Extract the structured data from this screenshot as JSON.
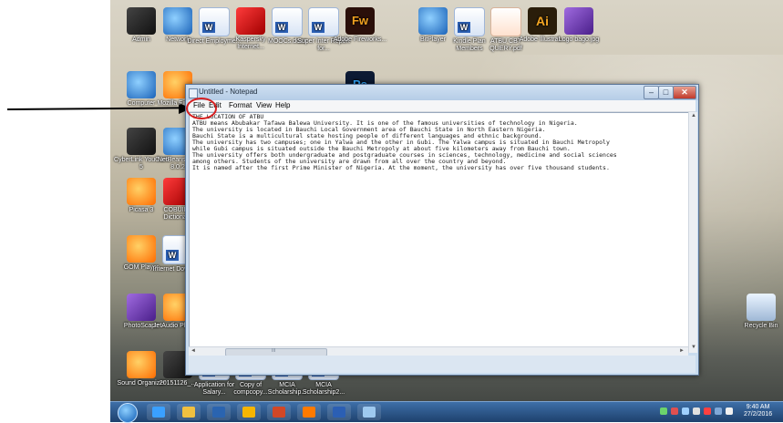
{
  "desktop": {
    "icons": [
      {
        "label": "Admin",
        "glyph": "g-dark",
        "icon": "user-folder-icon"
      },
      {
        "label": "Network",
        "glyph": "g-blue",
        "icon": "network-globe-icon"
      },
      {
        "label": "Direct Employme...",
        "glyph": "g-doc",
        "icon": "word-document-icon"
      },
      {
        "label": "Kaspersky Internet...",
        "glyph": "g-red",
        "icon": "kaspersky-icon"
      },
      {
        "label": "MOOCs.docx",
        "glyph": "g-doc",
        "icon": "word-document-icon"
      },
      {
        "label": "Super Inter Report for...",
        "glyph": "g-doc",
        "icon": "word-document-icon"
      },
      {
        "label": "Adobe Fireworks...",
        "glyph": "g-adobe",
        "icon": "fireworks-icon",
        "short": "Fw"
      },
      {
        "label": "BitPlayer",
        "glyph": "g-blue",
        "icon": "player-icon"
      },
      {
        "label": "Kindle Plan Members",
        "glyph": "g-doc",
        "icon": "word-document-icon"
      },
      {
        "label": "ATBU CBT QUERY.pdf",
        "glyph": "g-pdf",
        "icon": "pdf-document-icon"
      },
      {
        "label": "Adobe Illustrat...",
        "glyph": "g-ai",
        "icon": "illustrator-icon",
        "short": "Ai"
      },
      {
        "label": "Logo bago.jpg",
        "glyph": "g-purple",
        "icon": "image-file-icon"
      },
      {
        "label": "Computer",
        "glyph": "g-blue",
        "icon": "computer-icon"
      },
      {
        "label": "Mozilla Firefox",
        "glyph": "g-orange",
        "icon": "firefox-icon"
      },
      {
        "label": "CyberLink YouCam 5",
        "glyph": "g-dark",
        "icon": "webcam-icon"
      },
      {
        "label": "NetBeans IDE 8.0.2",
        "glyph": "g-blue",
        "icon": "netbeans-cube-icon"
      },
      {
        "label": "Picasa 3",
        "glyph": "g-orange",
        "icon": "picasa-icon"
      },
      {
        "label": "COBUILD Dictionary",
        "glyph": "g-red",
        "icon": "dictionary-icon"
      },
      {
        "label": "GOM Player",
        "glyph": "g-orange",
        "icon": "gom-player-icon"
      },
      {
        "label": "Internet Downlo...",
        "glyph": "g-doc",
        "icon": "internet-download-icon"
      },
      {
        "label": "PhotoScape",
        "glyph": "g-purple",
        "icon": "photoscape-icon"
      },
      {
        "label": "JetAudio Plus VX",
        "glyph": "g-orange",
        "icon": "jetaudio-icon"
      },
      {
        "label": "Sound Organizer",
        "glyph": "g-orange",
        "icon": "sound-organizer-icon"
      },
      {
        "label": "20151126_...",
        "glyph": "g-dark",
        "icon": "image-file-icon"
      },
      {
        "label": "Application for Salary...",
        "glyph": "g-doc",
        "icon": "word-document-icon"
      },
      {
        "label": "Copy of compcopy...",
        "glyph": "g-doc",
        "icon": "word-document-icon"
      },
      {
        "label": "MCIA Scholarship...",
        "glyph": "g-doc",
        "icon": "word-document-icon"
      },
      {
        "label": "MCIA Scholarship2...",
        "glyph": "g-doc",
        "icon": "word-document-icon"
      },
      {
        "label": "Recycle Bin",
        "glyph": "g-recycle",
        "icon": "recycle-bin-icon"
      },
      {
        "label": "Adobe Photoshop",
        "glyph": "g-ps",
        "icon": "photoshop-icon",
        "short": "Ps"
      }
    ]
  },
  "notepad": {
    "title": "Untitled - Notepad",
    "controls": {
      "minimize": "–",
      "maximize": "□",
      "close": "✕"
    },
    "menu": [
      "File",
      "Edit",
      "Format",
      "View",
      "Help"
    ],
    "text": "THE LOCATION OF ATBU\nATBU means Abubakar Tafawa Balewa University. It is one of the famous universities of technology in Nigeria.\nThe university is located in Bauchi Local Government area of Bauchi State in North Eastern Nigeria.\nBauchi State is a multicultural state hosting people of different languages and ethnic background.\nThe university has two campuses; one in Yalwa and the other in Gubi. The Yalwa campus is situated in Bauchi Metropoly\nwhile Gubi campus is situated outside the Bauchi Metropoly at about five kilometers away from Bauchi town.\nThe university offers both undergraduate and postgraduate courses in sciences, technology, medicine and social sciences\namong others. Students of the university are drawn from all over the country and beyond.\nIt is named after the first Prime Minister of Nigeria. At the moment, the university has over five thousand students.",
    "scroll": {
      "up": "▲",
      "down": "▼",
      "left": "◄",
      "right": "►",
      "thumb": "III"
    }
  },
  "taskbar": {
    "items": [
      {
        "icon": "internet-explorer-icon",
        "color": "#3aa0ff"
      },
      {
        "icon": "file-explorer-icon",
        "color": "#f0c040"
      },
      {
        "icon": "media-player-icon",
        "color": "#2a64b0"
      },
      {
        "icon": "chrome-icon",
        "color": "#f7b500"
      },
      {
        "icon": "powerpoint-icon",
        "color": "#d24726"
      },
      {
        "icon": "firefox-icon",
        "color": "#ff7a00"
      },
      {
        "icon": "word-icon",
        "color": "#2b5fb4"
      },
      {
        "icon": "notepad-icon",
        "color": "#9ec9ef"
      }
    ],
    "clock_time": "9:40 AM",
    "clock_date": "27/2/2016"
  },
  "annotation": {
    "highlight": "File menu"
  }
}
